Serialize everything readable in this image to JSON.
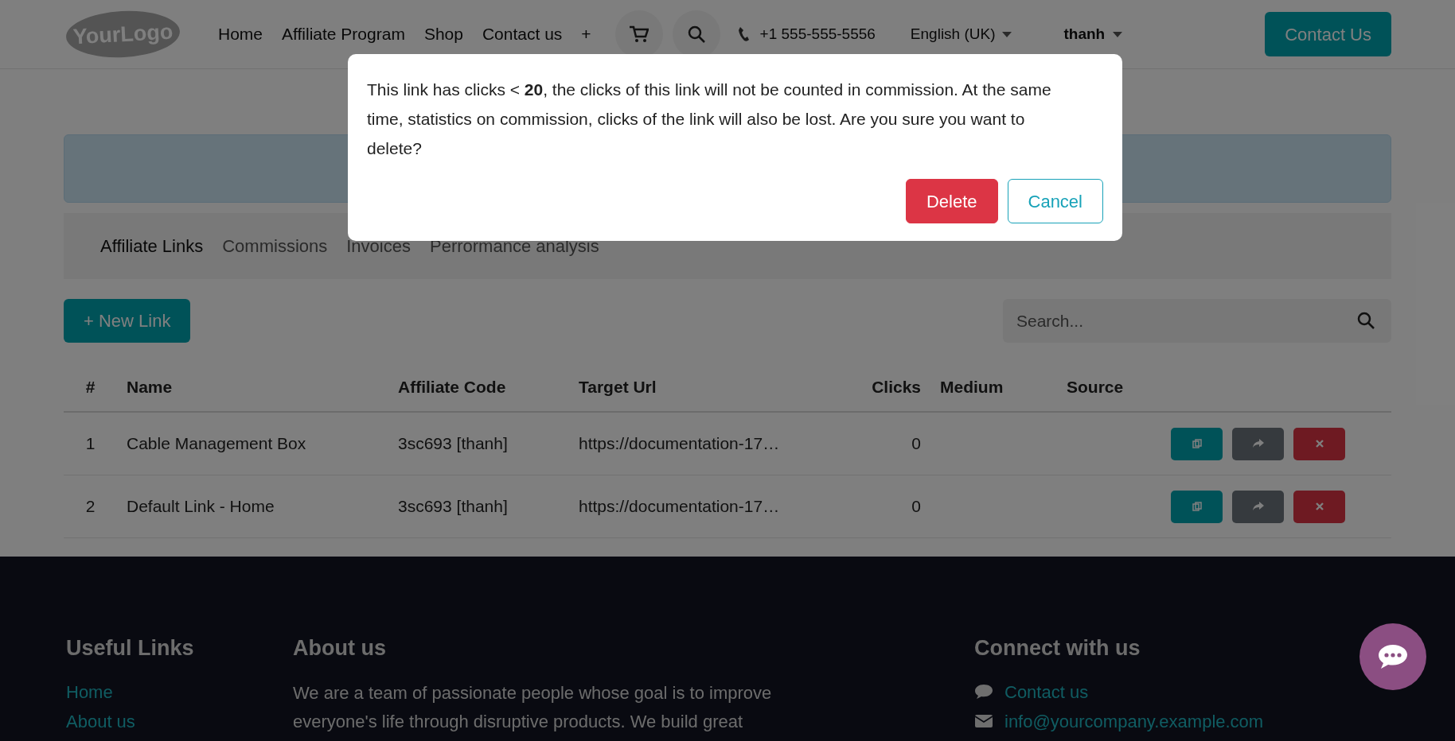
{
  "header": {
    "logo": "YourLogo",
    "nav": [
      {
        "label": "Home"
      },
      {
        "label": "Affiliate Program"
      },
      {
        "label": "Shop"
      },
      {
        "label": "Contact us"
      },
      {
        "label": "+"
      }
    ],
    "phone": "+1 555-555-5556",
    "language": "English (UK)",
    "user": "thanh",
    "contact_button": "Contact Us"
  },
  "tabs": [
    {
      "label": "Affiliate Links",
      "selected": true
    },
    {
      "label": "Commissions",
      "selected": false
    },
    {
      "label": "Invoices",
      "selected": false
    },
    {
      "label": "Perrormance analysis",
      "selected": false
    }
  ],
  "new_link_button": "+ New Link",
  "search": {
    "placeholder": "Search..."
  },
  "table": {
    "columns": [
      {
        "label": "#"
      },
      {
        "label": "Name"
      },
      {
        "label": "Affiliate Code"
      },
      {
        "label": "Target Url"
      },
      {
        "label": "Clicks"
      },
      {
        "label": "Medium"
      },
      {
        "label": "Source"
      }
    ],
    "rows": [
      {
        "cells": [
          "1",
          "Cable Management Box",
          "3sc693 [thanh]",
          "https://documentation-17…",
          "0"
        ]
      },
      {
        "cells": [
          "2",
          "Default Link - Home",
          "3sc693 [thanh]",
          "https://documentation-17…",
          "0"
        ]
      }
    ]
  },
  "footer": {
    "useful_links": {
      "title": "Useful Links",
      "links": [
        "Home",
        "About us"
      ]
    },
    "about": {
      "title": "About us",
      "text": "We are a team of passionate people whose goal is to improve everyone's life through disruptive products. We build great"
    },
    "connect": {
      "title": "Connect with us",
      "items": [
        {
          "kind": "chat",
          "label": "Contact us"
        },
        {
          "kind": "mail",
          "label": "info@yourcompany.example.com"
        }
      ]
    }
  },
  "dialog": {
    "message": "This link has clicks < **20**, the clicks of this link will not be counted in commission. At the same time, statistics on commission, clicks of the link will also be lost. Are you sure you want to delete?",
    "buttons": [
      {
        "kind": "danger",
        "label": "Delete"
      },
      {
        "kind": "outline",
        "label": "Cancel"
      }
    ]
  }
}
